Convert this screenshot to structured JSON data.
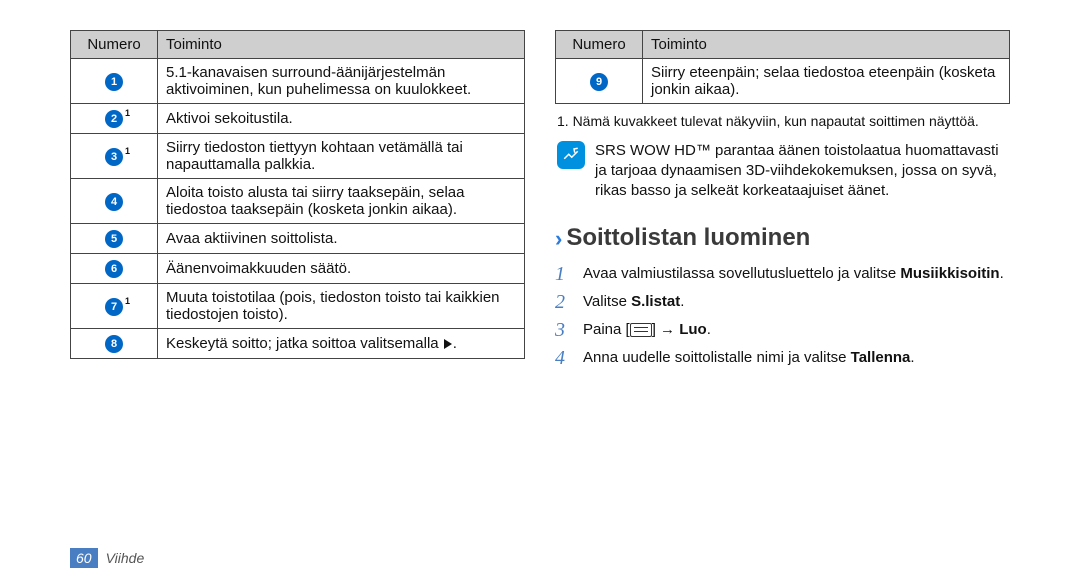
{
  "left_table": {
    "headers": {
      "num": "Numero",
      "func": "Toiminto"
    },
    "rows": [
      {
        "n": "1",
        "sup": false,
        "text": "5.1-kanavaisen surround-äänijärjestelmän aktivoiminen, kun puhelimessa on kuulokkeet."
      },
      {
        "n": "2",
        "sup": true,
        "text": "Aktivoi sekoitustila."
      },
      {
        "n": "3",
        "sup": true,
        "text": "Siirry tiedoston tiettyyn kohtaan vetämällä tai napauttamalla palkkia."
      },
      {
        "n": "4",
        "sup": false,
        "text": "Aloita toisto alusta tai siirry taaksepäin, selaa tiedostoa taaksepäin (kosketa jonkin aikaa)."
      },
      {
        "n": "5",
        "sup": false,
        "text": "Avaa aktiivinen soittolista."
      },
      {
        "n": "6",
        "sup": false,
        "text": "Äänenvoimakkuuden säätö."
      },
      {
        "n": "7",
        "sup": true,
        "text": "Muuta toistotilaa (pois, tiedoston toisto tai kaikkien tiedostojen toisto)."
      },
      {
        "n": "8",
        "sup": false,
        "text_pre": "Keskeytä soitto; jatka soittoa valitsemalla ",
        "text_post": "."
      }
    ]
  },
  "right_table": {
    "headers": {
      "num": "Numero",
      "func": "Toiminto"
    },
    "rows": [
      {
        "n": "9",
        "sup": false,
        "text": "Siirry eteenpäin; selaa tiedostoa eteenpäin (kosketa jonkin aikaa)."
      }
    ]
  },
  "footnote": "1. Nämä kuvakkeet tulevat näkyviin, kun napautat soittimen näyttöä.",
  "note": "SRS WOW HD™ parantaa äänen toistolaatua huomattavasti ja tarjoaa dynaamisen 3D-viihdekokemuksen, jossa on syvä, rikas basso ja selkeät korkeataajuiset äänet.",
  "section_title": "Soittolistan luominen",
  "steps": {
    "s1_a": "Avaa valmiustilassa sovellutusluettelo ja valitse ",
    "s1_b": "Musiikkisoitin",
    "s1_c": ".",
    "s2_a": "Valitse ",
    "s2_b": "S.listat",
    "s2_c": ".",
    "s3_a": "Paina [",
    "s3_b": "] → ",
    "s3_c": "Luo",
    "s3_d": ".",
    "s4_a": "Anna uudelle soittolistalle nimi ja valitse ",
    "s4_b": "Tallenna",
    "s4_c": "."
  },
  "step_numbers": {
    "s1": "1",
    "s2": "2",
    "s3": "3",
    "s4": "4"
  },
  "footer": {
    "page": "60",
    "section": "Viihde"
  }
}
